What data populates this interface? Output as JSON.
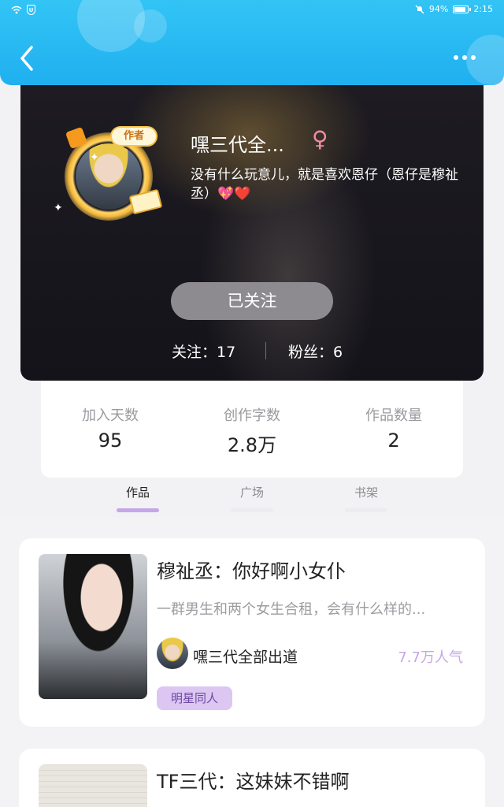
{
  "status_bar": {
    "battery": "94%",
    "battery_level": 0.94,
    "time": "2:15"
  },
  "header": {
    "back_icon": "chevron-left-icon",
    "more_icon": "more-horizontal-icon"
  },
  "profile": {
    "name": "嘿三代全...",
    "gender_symbol": "♀",
    "badge": "作者",
    "bio": "没有什么玩意儿，就是喜欢恩仔（恩仔是穆祉丞）💖❤️",
    "follow_button": "已关注",
    "following": "关注：17",
    "fans": "粉丝：6"
  },
  "stats": [
    {
      "label": "加入天数",
      "value": "95"
    },
    {
      "label": "创作字数",
      "value": "2.8万"
    },
    {
      "label": "作品数量",
      "value": "2"
    }
  ],
  "tabs": [
    {
      "label": "作品",
      "active": true
    },
    {
      "label": "广场",
      "active": false
    },
    {
      "label": "书架",
      "active": false
    }
  ],
  "works": [
    {
      "title": "穆祉丞：你好啊小女仆",
      "description": "一群男生和两个女生合租，会有什么样的...",
      "author": "嘿三代全部出道",
      "popularity": "7.7万人气",
      "tag": "明星同人"
    },
    {
      "title": "TF三代：这妹妹不错啊"
    }
  ],
  "colors": {
    "header": "#1fb0f0",
    "accent_purple": "#c7a6e8",
    "tag_bg": "#dcc6f2"
  }
}
